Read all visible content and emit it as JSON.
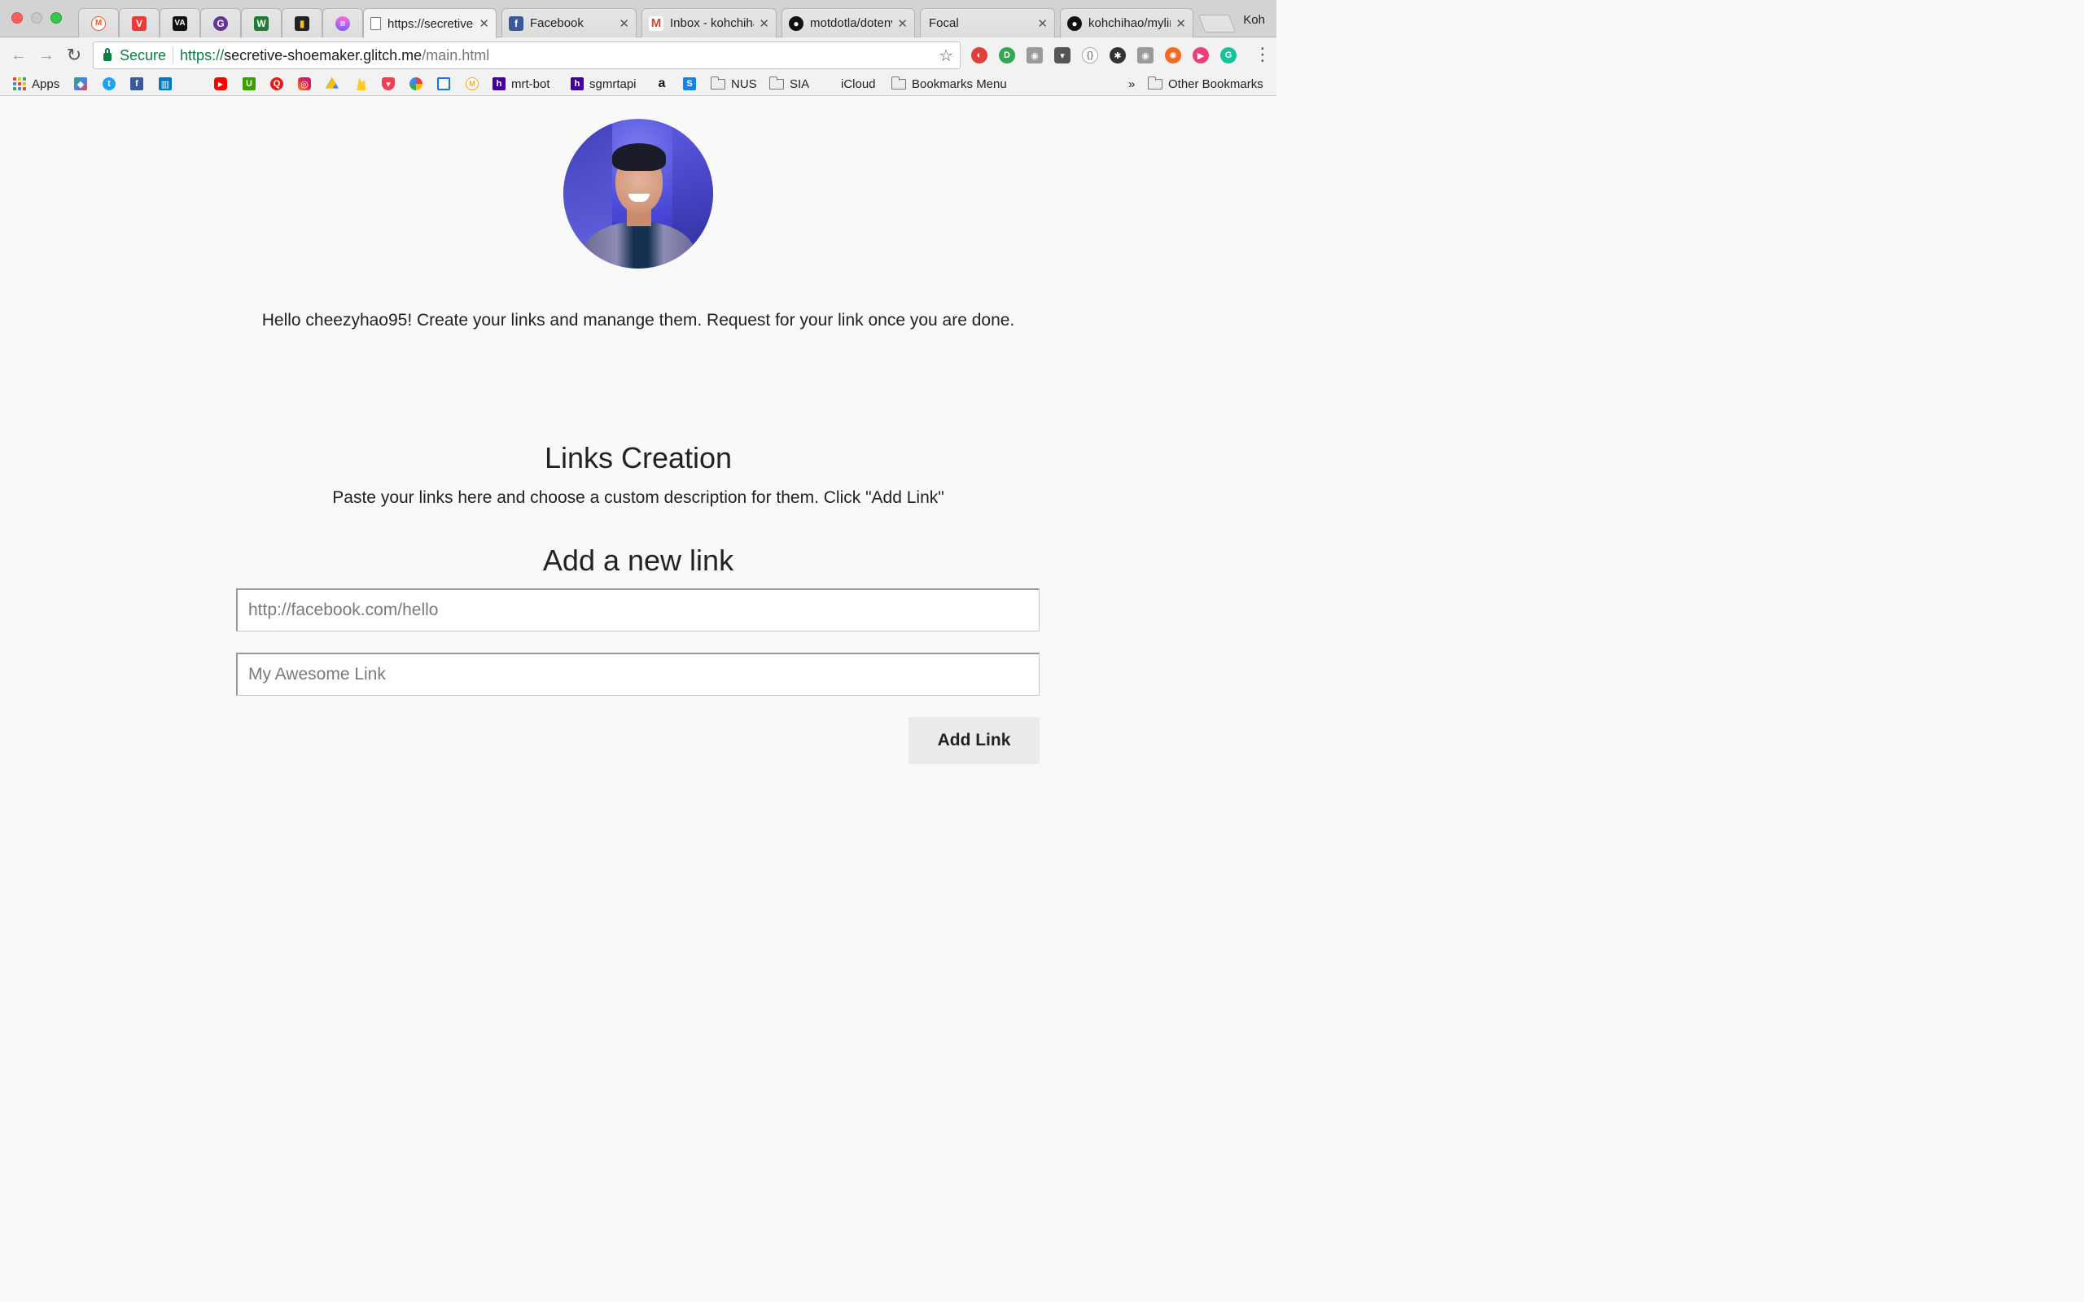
{
  "browser": {
    "tabs": [
      {
        "label": "",
        "icon": "maker-m-icon",
        "color": "#f05a28"
      },
      {
        "label": "",
        "icon": "vivaldi-icon",
        "color": "#ef3939"
      },
      {
        "label": "",
        "icon": "va-icon",
        "color": "#111111"
      },
      {
        "label": "",
        "icon": "gatsby-icon",
        "color": "#663399"
      },
      {
        "label": "",
        "icon": "wiki-w-icon",
        "color": "#1e7b34"
      },
      {
        "label": "",
        "icon": "bar-icon",
        "color": "#222222"
      },
      {
        "label": "",
        "icon": "stack-icon",
        "color": "#9b5de5"
      },
      {
        "label": "https://secretive-shoemaker.glitch.me",
        "icon": "page-icon",
        "active": true
      },
      {
        "label": "Facebook",
        "icon": "facebook-icon",
        "color": "#3b5998"
      },
      {
        "label": "Inbox - kohchihao",
        "icon": "gmail-icon",
        "color": "#d44638"
      },
      {
        "label": "motdotla/dotenv",
        "icon": "github-icon",
        "color": "#111111"
      },
      {
        "label": "Focal",
        "icon": "none"
      },
      {
        "label": "kohchihao/mylink",
        "icon": "github-icon",
        "color": "#111111"
      }
    ],
    "profile_name": "Koh",
    "address": {
      "secure_label": "Secure",
      "scheme": "https://",
      "host": "secretive-shoemaker.glitch.me",
      "path": "/main.html"
    },
    "bookmarks": [
      {
        "label": "Apps",
        "icon": "apps-grid-icon"
      },
      {
        "label": "",
        "icon": "maps-icon",
        "color": "#34a853"
      },
      {
        "label": "",
        "icon": "twitter-icon",
        "color": "#1da1f2"
      },
      {
        "label": "",
        "icon": "facebook-icon",
        "color": "#3b5998"
      },
      {
        "label": "",
        "icon": "trello-icon",
        "color": "#0079bf"
      },
      {
        "label": "",
        "icon": "apple-icon",
        "color": "#777777"
      },
      {
        "label": "",
        "icon": "youtube-icon",
        "color": "#ff0000"
      },
      {
        "label": "",
        "icon": "upwork-icon",
        "color": "#37a000"
      },
      {
        "label": "",
        "icon": "quora-icon",
        "color": "#e01e1e"
      },
      {
        "label": "",
        "icon": "instagram-icon",
        "color": "#c13584"
      },
      {
        "label": "",
        "icon": "drive-icon",
        "color": "#fbbc04"
      },
      {
        "label": "",
        "icon": "firebase-icon",
        "color": "#ffca28"
      },
      {
        "label": "",
        "icon": "pocket-icon",
        "color": "#ef3f56"
      },
      {
        "label": "",
        "icon": "photos-icon",
        "color": "#ea4335"
      },
      {
        "label": "",
        "icon": "frame-icon",
        "color": "#1a73e8"
      },
      {
        "label": "",
        "icon": "maker-m-icon",
        "color": "#f5a623"
      },
      {
        "label": "mrt-bot",
        "icon": "heroku-icon",
        "color": "#430098"
      },
      {
        "label": "sgmrtapi",
        "icon": "heroku-icon",
        "color": "#430098"
      },
      {
        "label": "",
        "icon": "amazon-icon",
        "color": "#111111"
      },
      {
        "label": "",
        "icon": "s-icon",
        "color": "#1a82e2"
      },
      {
        "label": "NUS",
        "icon": "folder-icon"
      },
      {
        "label": "SIA",
        "icon": "folder-icon"
      },
      {
        "label": "iCloud",
        "icon": "apple-icon",
        "color": "#555555"
      },
      {
        "label": "Bookmarks Menu",
        "icon": "folder-icon"
      }
    ],
    "overflow_label": "»",
    "other_bookmarks": "Other Bookmarks"
  },
  "page": {
    "intro_text": "Hello cheezyhao95! Create your links and manange them. Request for your link once you are done.",
    "section_title": "Links Creation",
    "section_subtitle": "Paste your links here and choose a custom description for them. Click \"Add Link\"",
    "form_title": "Add a new link",
    "url_placeholder": "http://facebook.com/hello",
    "desc_placeholder": "My Awesome Link",
    "add_button_label": "Add Link"
  }
}
